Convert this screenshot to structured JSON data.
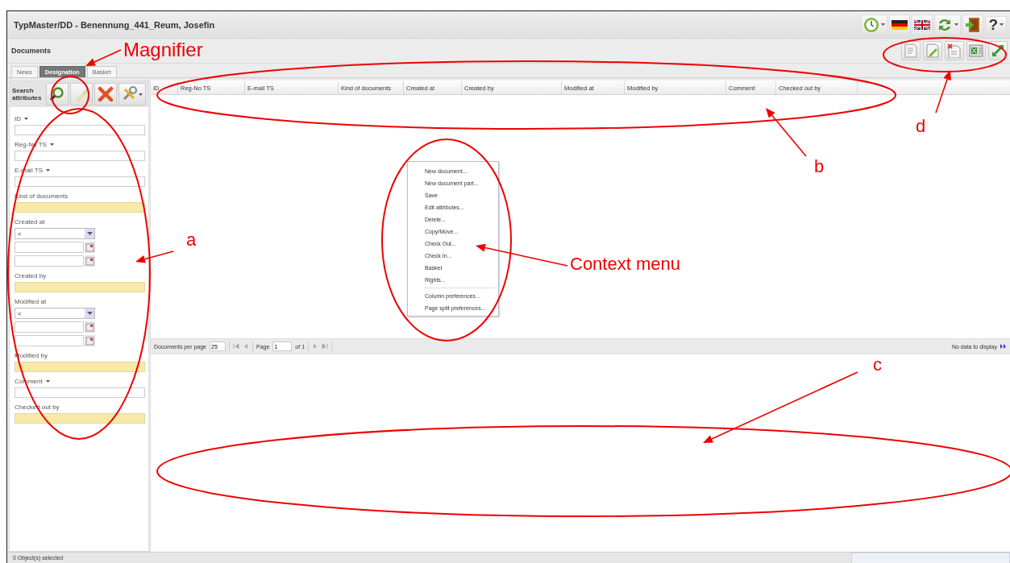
{
  "window": {
    "title": "TypMaster/DD - Benennung_441_Reum, Josefin"
  },
  "header_tools": [
    {
      "kind": "clock",
      "menu": true
    },
    {
      "kind": "flag-de",
      "menu": false
    },
    {
      "kind": "flag-uk",
      "menu": false
    },
    {
      "kind": "sync",
      "menu": true
    },
    {
      "kind": "exit",
      "menu": false
    },
    {
      "kind": "help",
      "label": "?",
      "menu": true
    }
  ],
  "module": {
    "title": "Documents"
  },
  "view_tools": [
    {
      "kind": "document"
    },
    {
      "kind": "edit"
    },
    {
      "kind": "delete"
    },
    {
      "kind": "excel"
    },
    {
      "kind": "expand"
    }
  ],
  "tabs": [
    {
      "label": "News",
      "selected": false
    },
    {
      "label": "Designation",
      "selected": true
    },
    {
      "label": "Basket",
      "selected": false
    }
  ],
  "search": {
    "title": "Search attributes",
    "tools": [
      {
        "kind": "search",
        "disabled": false
      },
      {
        "kind": "clear",
        "disabled": true
      },
      {
        "kind": "delete",
        "disabled": false
      },
      {
        "kind": "tools",
        "disabled": false
      }
    ],
    "fields": [
      {
        "kind": "text",
        "label": "ID",
        "menu": true
      },
      {
        "kind": "text",
        "label": "Reg-No TS",
        "menu": true
      },
      {
        "kind": "text",
        "label": "E-mail TS",
        "menu": true
      },
      {
        "kind": "lookup",
        "label": "Kind of documents"
      },
      {
        "kind": "date",
        "label": "Created at",
        "operator": "<"
      },
      {
        "kind": "lookup",
        "label": "Created by"
      },
      {
        "kind": "date",
        "label": "Modified at",
        "operator": "<"
      },
      {
        "kind": "lookup",
        "label": "Modified by"
      },
      {
        "kind": "text",
        "label": "Comment",
        "menu": true
      },
      {
        "kind": "lookup",
        "label": "Checked out by"
      }
    ]
  },
  "table": {
    "columns": [
      "ID",
      "Reg-No TS",
      "E-mail TS",
      "Kind of documents",
      "Created at",
      "Created by",
      "Modified at",
      "Modified by",
      "Comment",
      "Checked out by"
    ]
  },
  "context_menu": {
    "sections": [
      {
        "items": [
          "New document...",
          "New document part...",
          "Save",
          "Edit attributes...",
          "Delete...",
          "Copy/Move...",
          "Check Out...",
          "Check In...",
          "Basket",
          "Rights..."
        ]
      },
      {
        "items": [
          "Column preferences...",
          "Page split preferences..."
        ]
      }
    ]
  },
  "pager": {
    "label": "Documents per page",
    "page_size": "25",
    "page_label": "Page",
    "page": "1",
    "page_count": "of 1",
    "info": "No data to display"
  },
  "status_bar": {
    "text": "0 Object(s) selected"
  },
  "annotations": [
    {
      "label": "Magnifier"
    },
    {
      "label": "a"
    },
    {
      "label": "Context menu"
    },
    {
      "label": "b"
    },
    {
      "label": "c"
    },
    {
      "label": "d"
    }
  ]
}
